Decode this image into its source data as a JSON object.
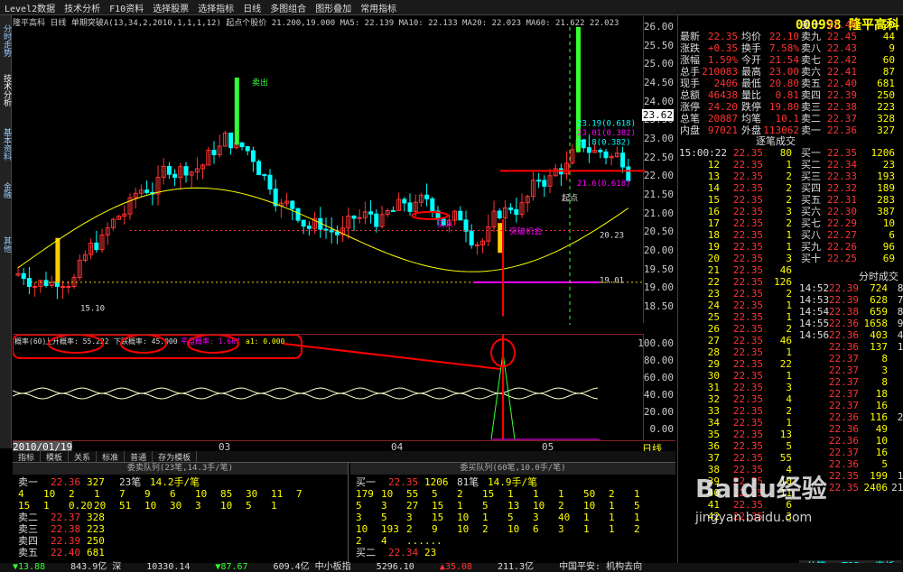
{
  "menu": [
    "Level2数据",
    "技术分析",
    "F10资料",
    "选择股票",
    "选择指标",
    "日线",
    "多图组合",
    "图形叠加",
    "常用指标"
  ],
  "left_tabs": [
    "分时走势",
    "技术分析",
    "基本资料",
    "金融",
    "其他"
  ],
  "chart_info": "隆平高科 日线 单期突破A(13,34,2,2010,1,1,1,12) 起点个股价 21.200,19.000 MA5: 22.139 MA10: 22.133 MA20: 22.023 MA60: 21.622 22.023",
  "y_labels": [
    "26.00",
    "25.50",
    "25.00",
    "24.50",
    "24.00",
    "23.50",
    "23.00",
    "22.50",
    "22.00",
    "21.50",
    "21.00",
    "20.50",
    "20.00",
    "19.50",
    "19.00",
    "18.50"
  ],
  "y_marker": "23.62",
  "chart_annotations": {
    "sell": "卖出",
    "buy_start": "起点",
    "price_a": "25.97",
    "v1": "23.19(0.618)",
    "v2": "23.01(0.382)",
    "v3": "22.8(0.382)",
    "v4": "21.6(0.618)",
    "low_a": "19.01",
    "low_b": "15.10",
    "low_c": "20.23",
    "chance": "突破机会",
    "buy": "买入"
  },
  "indicator": {
    "name": "概率(60)",
    "up": "上升概率: 55.222",
    "down": "下跌概率: 45.000",
    "flat": "平盘概率: 1.667",
    "a1": "a1: 0.000",
    "axis": [
      "100.00",
      "80.00",
      "60.00",
      "40.00",
      "20.00",
      "0.00"
    ]
  },
  "dates": [
    "2010/01/19",
    "03",
    "04",
    "05"
  ],
  "period": "日线",
  "bottom_tabs": [
    "指标",
    "模板",
    "关系",
    "标准",
    "普通",
    "存为模板"
  ],
  "quote": {
    "code": "000998 隆平高科",
    "rows_left": [
      [
        "最新",
        "22.35"
      ],
      [
        "涨跌",
        "+0.35"
      ],
      [
        "涨幅",
        "1.59%"
      ],
      [
        "总手",
        "210083"
      ],
      [
        "现手",
        "2406"
      ],
      [
        "总额",
        "46438"
      ],
      [
        "涨停",
        "24.20"
      ],
      [
        "总笔",
        "20887"
      ],
      [
        "内盘",
        "97021"
      ]
    ],
    "rows_mid": [
      [
        "均价",
        "22.10"
      ],
      [
        "换手",
        "7.58%"
      ],
      [
        "今开",
        "21.54"
      ],
      [
        "最高",
        "23.00"
      ],
      [
        "最低",
        "20.80"
      ],
      [
        "量比",
        "0.81"
      ],
      [
        "跌停",
        "19.80"
      ],
      [
        "均笔",
        "10.1"
      ],
      [
        "外盘",
        "113062"
      ]
    ],
    "sell_levels": [
      [
        "卖十",
        "22.48",
        "20"
      ],
      [
        "卖九",
        "22.45",
        "44"
      ],
      [
        "卖八",
        "22.43",
        "9"
      ],
      [
        "卖七",
        "22.42",
        "60"
      ],
      [
        "卖六",
        "22.41",
        "87"
      ],
      [
        "卖五",
        "22.40",
        "681"
      ],
      [
        "卖四",
        "22.39",
        "250"
      ],
      [
        "卖三",
        "22.38",
        "223"
      ],
      [
        "卖二",
        "22.37",
        "328"
      ],
      [
        "卖一",
        "22.36",
        "327"
      ]
    ],
    "buy_levels": [
      [
        "买一",
        "22.35",
        "1206"
      ],
      [
        "买二",
        "22.34",
        "23"
      ],
      [
        "买三",
        "22.33",
        "193"
      ],
      [
        "买四",
        "22.32",
        "189"
      ],
      [
        "买五",
        "22.31",
        "283"
      ],
      [
        "买六",
        "22.30",
        "387"
      ],
      [
        "买七",
        "22.29",
        "10"
      ],
      [
        "买八",
        "22.27",
        "6"
      ],
      [
        "买九",
        "22.26",
        "96"
      ],
      [
        "买十",
        "22.25",
        "69"
      ]
    ],
    "trade_title": "逐笔成交",
    "trade_time": "15:00:22",
    "trades": [
      [
        "12",
        "22.35",
        "80"
      ],
      [
        "12",
        "22.35",
        "1"
      ],
      [
        "13",
        "22.35",
        "2"
      ],
      [
        "14",
        "22.35",
        "2"
      ],
      [
        "15",
        "22.35",
        "2"
      ],
      [
        "16",
        "22.35",
        "3"
      ],
      [
        "17",
        "22.35",
        "2"
      ],
      [
        "18",
        "22.35",
        "1"
      ],
      [
        "19",
        "22.35",
        "1"
      ],
      [
        "20",
        "22.35",
        "3"
      ],
      [
        "21",
        "22.35",
        "46"
      ],
      [
        "22",
        "22.35",
        "126"
      ],
      [
        "23",
        "22.35",
        "2"
      ],
      [
        "24",
        "22.35",
        "1"
      ],
      [
        "25",
        "22.35",
        "1"
      ],
      [
        "26",
        "22.35",
        "2"
      ],
      [
        "27",
        "22.35",
        "46"
      ],
      [
        "28",
        "22.35",
        "1"
      ],
      [
        "29",
        "22.35",
        "22"
      ],
      [
        "30",
        "22.35",
        "1"
      ],
      [
        "31",
        "22.35",
        "3"
      ],
      [
        "32",
        "22.35",
        "4"
      ],
      [
        "33",
        "22.35",
        "2"
      ],
      [
        "34",
        "22.35",
        "1"
      ],
      [
        "35",
        "22.35",
        "13"
      ],
      [
        "36",
        "22.35",
        "5"
      ],
      [
        "37",
        "22.35",
        "55"
      ],
      [
        "38",
        "22.35",
        "4"
      ],
      [
        "39",
        "22.35",
        "10"
      ],
      [
        "40",
        "22.35",
        "11"
      ],
      [
        "41",
        "22.35",
        "6"
      ],
      [
        "42",
        "22.35",
        "3"
      ]
    ],
    "tick_title": "分时成交",
    "ticks": [
      [
        "14:52",
        "22.39",
        "724",
        "86"
      ],
      [
        "14:53",
        "22.39",
        "628",
        "75"
      ],
      [
        "14:54",
        "22.38",
        "659",
        "81"
      ],
      [
        "14:55",
        "22.36",
        "1658",
        "91"
      ],
      [
        "14:56",
        "22.36",
        "403",
        "45"
      ],
      [
        "",
        "22.36",
        "137",
        "17"
      ],
      [
        "",
        "22.37",
        "8",
        "5"
      ],
      [
        "",
        "22.37",
        "3",
        "2"
      ],
      [
        "",
        "22.37",
        "8",
        "1"
      ],
      [
        "",
        "22.37",
        "18",
        "5"
      ],
      [
        "",
        "22.37",
        "16",
        "6"
      ],
      [
        "",
        "22.36",
        "116",
        "25"
      ],
      [
        "",
        "22.36",
        "49",
        "9"
      ],
      [
        "",
        "22.36",
        "10",
        "4"
      ],
      [
        "",
        "22.37",
        "16",
        "7"
      ],
      [
        "",
        "22.36",
        "5",
        "1"
      ],
      [
        "",
        "22.35",
        "199",
        "14"
      ],
      [
        "",
        "22.35",
        "2406",
        "213"
      ]
    ],
    "tabs": [
      "分笔",
      "TOP",
      "表托"
    ]
  },
  "bottom_left": {
    "title": "委卖队列(23笔,14.3手/笔)",
    "levels": [
      [
        "卖一",
        "22.36",
        "327",
        "23笔",
        "14.2手/笔"
      ],
      [
        "卖二",
        "22.37",
        "328"
      ],
      [
        "卖三",
        "22.38",
        "223"
      ],
      [
        "卖四",
        "22.39",
        "250"
      ],
      [
        "卖五",
        "22.40",
        "681"
      ]
    ],
    "queue1": [
      "4",
      "10",
      "2",
      "1",
      "7",
      "9",
      "6",
      "10",
      "85",
      "30",
      "11",
      "7"
    ],
    "queue2": [
      "15",
      "1",
      "0.20",
      "20",
      "51",
      "10",
      "30",
      "3",
      "10",
      "5",
      "1"
    ]
  },
  "bottom_right": {
    "title": "委买队列(60笔,10.0手/笔)",
    "levels": [
      [
        "买一",
        "22.35",
        "1206",
        "81笔",
        "14.9手/笔"
      ],
      [
        "买二",
        "22.34",
        "23"
      ]
    ],
    "queue1": [
      "179",
      "10",
      "55",
      "5",
      "2",
      "15",
      "1",
      "1",
      "1",
      "50",
      "2",
      "1"
    ],
    "queue2": [
      "5",
      "3",
      "27",
      "15",
      "1",
      "5",
      "13",
      "10",
      "2",
      "10",
      "1",
      "5"
    ],
    "queue3": [
      "3",
      "5",
      "3",
      "15",
      "10",
      "1",
      "5",
      "3",
      "40",
      "1",
      "1",
      "1"
    ],
    "queue4": [
      "10",
      "193",
      "2",
      "9",
      "10",
      "2",
      "10",
      "6",
      "3",
      "1",
      "1",
      "2"
    ],
    "queue5": [
      "2",
      "4",
      "......"
    ]
  },
  "status": [
    "▼13.88",
    "843.9亿 深",
    "10330.14",
    "▼87.67",
    "609.4亿 中小板指",
    "5296.10",
    "▲35.08",
    "211.3亿",
    "中国平安: 机构去向"
  ],
  "watermark": {
    "brand": "Baidu经验",
    "url": "jingyan.baidu.com"
  },
  "colors": {
    "up": "#ff3333",
    "down": "#33ff33",
    "ma": "#ffff00",
    "accent": "#ff0000"
  },
  "chart_data": {
    "type": "candlestick",
    "title": "隆平高科 日线",
    "ylim": [
      18.5,
      26
    ],
    "x_labels": [
      "2010/01/19",
      "03",
      "04",
      "05"
    ],
    "probability": {
      "up": 55.222,
      "down": 45.0,
      "flat": 1.667,
      "a1": 0.0
    }
  }
}
